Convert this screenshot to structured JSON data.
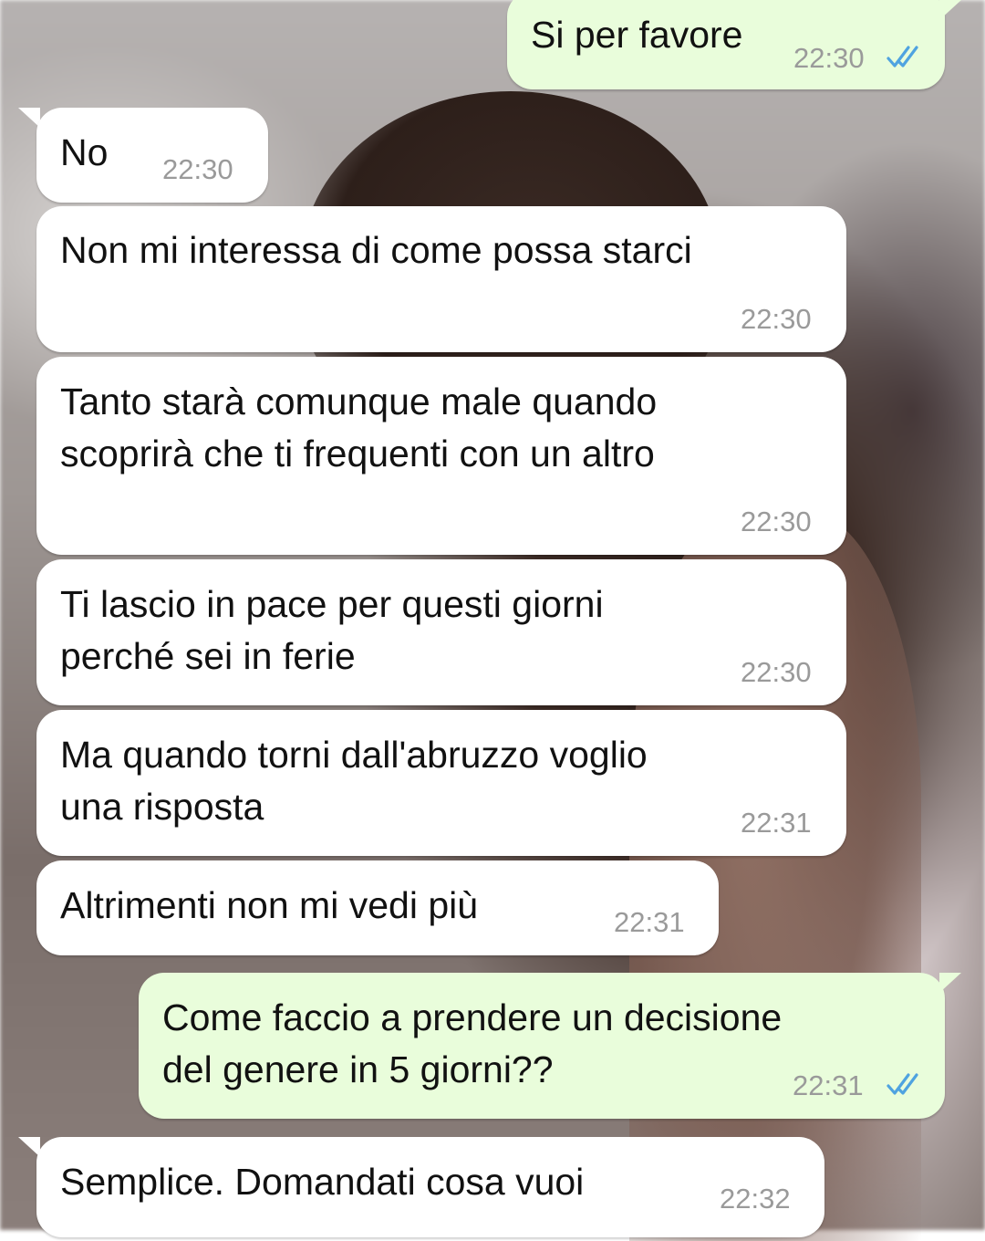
{
  "chat": {
    "messages": [
      {
        "direction": "out",
        "text": "Si per favore",
        "time": "22:30",
        "status": "read-double-tick-icon"
      },
      {
        "direction": "in",
        "text": "No",
        "time": "22:30"
      },
      {
        "direction": "in",
        "text": "Non mi interessa di come possa starci",
        "time": "22:30"
      },
      {
        "direction": "in",
        "text": "Tanto starà comunque male quando\nscoprirà che ti frequenti con un altro",
        "time": "22:30"
      },
      {
        "direction": "in",
        "text": "Ti lascio in pace per questi giorni\nperché sei in ferie",
        "time": "22:30"
      },
      {
        "direction": "in",
        "text": "Ma quando torni dall'abruzzo voglio\nuna risposta",
        "time": "22:31"
      },
      {
        "direction": "in",
        "text": "Altrimenti non mi vedi più",
        "time": "22:31"
      },
      {
        "direction": "out",
        "text": "Come faccio a prendere un decisione\ndel genere in 5 giorni??",
        "time": "22:31",
        "status": "read-double-tick-icon"
      },
      {
        "direction": "in",
        "text": "Semplice. Domandati cosa vuoi",
        "time": "22:32"
      }
    ]
  },
  "colors": {
    "incoming_bubble": "#ffffff",
    "outgoing_bubble": "#e9fddb",
    "timestamp": "#9a9a9a",
    "read_ticks": "#4fa3e0",
    "message_text": "#111111"
  }
}
